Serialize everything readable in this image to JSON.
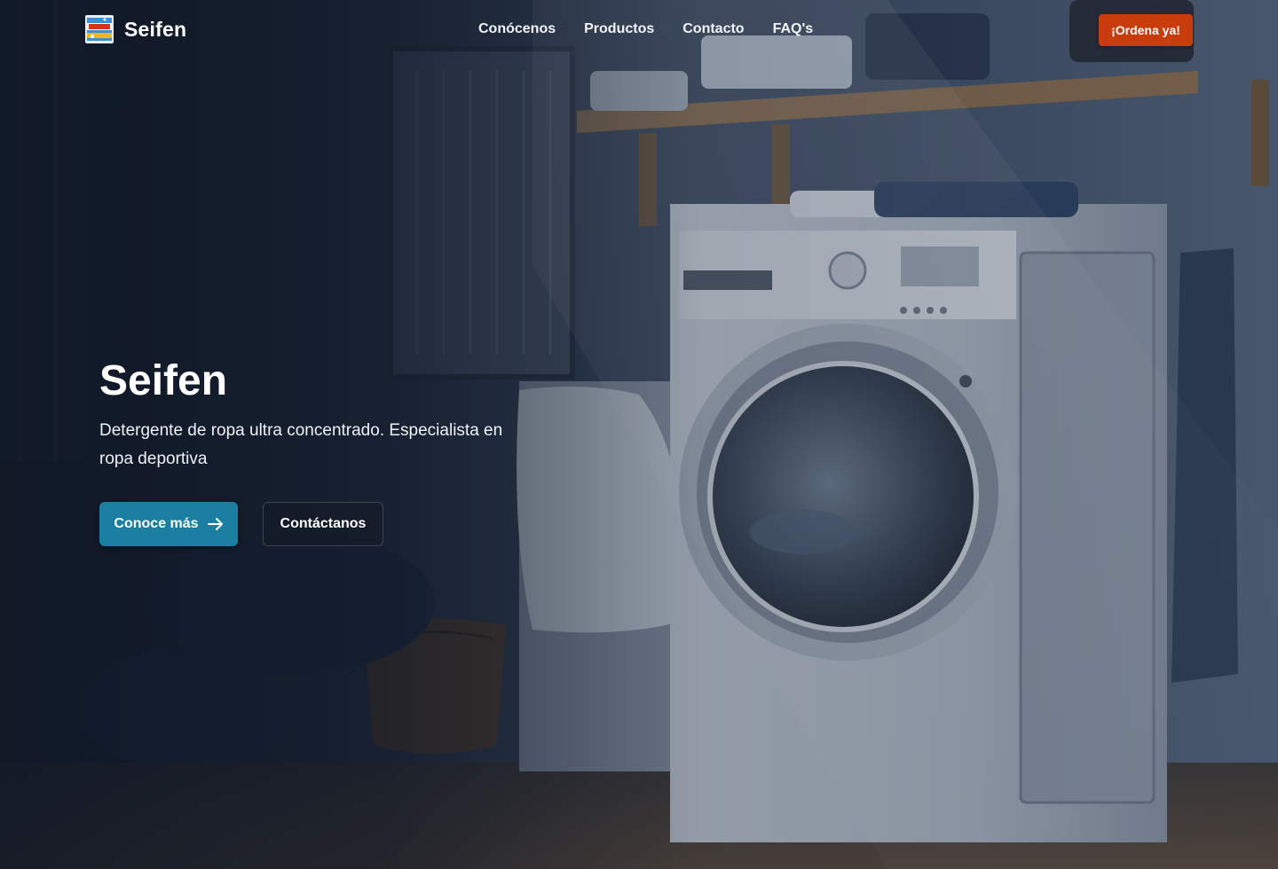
{
  "nav": {
    "brand": "Seifen",
    "logo_icon": "seifen-product-logo-icon",
    "links": [
      {
        "label": "Conócenos"
      },
      {
        "label": "Productos"
      },
      {
        "label": "Contacto"
      },
      {
        "label": "FAQ's"
      }
    ],
    "cta_label": "¡Ordena ya!"
  },
  "hero": {
    "title": "Seifen",
    "subtitle": "Detergente de ropa ultra concentrado. Especialista en ropa deportiva",
    "primary_button": "Conoce más",
    "primary_button_icon": "arrow-right-icon",
    "secondary_button": "Contáctanos",
    "background_image": "laundry-room-washing-machine-photo"
  },
  "colors": {
    "cta": "#c93c0c",
    "primary": "#1a7fa0",
    "overlay": "#0e1624"
  }
}
